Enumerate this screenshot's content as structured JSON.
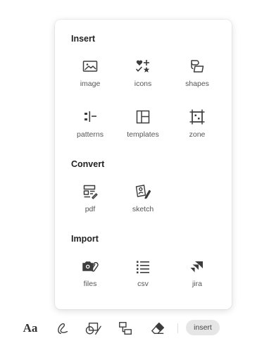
{
  "popover": {
    "sections": [
      {
        "title": "Insert",
        "items": [
          {
            "label": "image",
            "icon": "image-icon"
          },
          {
            "label": "icons",
            "icon": "icons-icon"
          },
          {
            "label": "shapes",
            "icon": "shapes-icon"
          },
          {
            "label": "patterns",
            "icon": "patterns-icon"
          },
          {
            "label": "templates",
            "icon": "templates-icon"
          },
          {
            "label": "zone",
            "icon": "zone-icon"
          }
        ]
      },
      {
        "title": "Convert",
        "items": [
          {
            "label": "pdf",
            "icon": "pdf-icon"
          },
          {
            "label": "sketch",
            "icon": "sketch-icon"
          }
        ]
      },
      {
        "title": "Import",
        "items": [
          {
            "label": "files",
            "icon": "files-icon"
          },
          {
            "label": "csv",
            "icon": "csv-icon"
          },
          {
            "label": "jira",
            "icon": "jira-icon"
          }
        ]
      }
    ]
  },
  "toolbar": {
    "text_tool_label": "Aa",
    "insert_label": "insert",
    "tools": [
      "text-icon",
      "pen-icon",
      "shape-icon",
      "connector-icon",
      "eraser-icon"
    ]
  },
  "colors": {
    "icon": "#3d3d3d",
    "label": "#555555",
    "pill_bg": "#e6e6e6"
  }
}
